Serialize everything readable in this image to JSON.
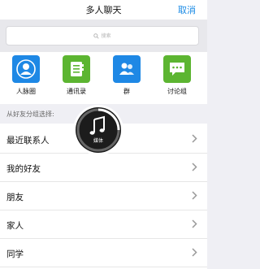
{
  "header": {
    "title": "多人聊天",
    "cancel_label": "取消"
  },
  "search": {
    "placeholder": "搜索"
  },
  "apps": [
    {
      "label": "人脉圈",
      "icon": "contacts-circle-icon",
      "color": "#1e88e5"
    },
    {
      "label": "通讯录",
      "icon": "address-book-icon",
      "color": "#5cb531"
    },
    {
      "label": "群",
      "icon": "group-icon",
      "color": "#1e88e5"
    },
    {
      "label": "讨论组",
      "icon": "discussion-icon",
      "color": "#5cb531"
    }
  ],
  "section": {
    "label": "从好友分组选择:"
  },
  "groups": [
    {
      "label": "最近联系人"
    },
    {
      "label": "我的好友"
    },
    {
      "label": "朋友"
    },
    {
      "label": "家人"
    },
    {
      "label": "同学"
    }
  ],
  "media_overlay": {
    "label": "媒体",
    "icon": "music-note-icon"
  }
}
